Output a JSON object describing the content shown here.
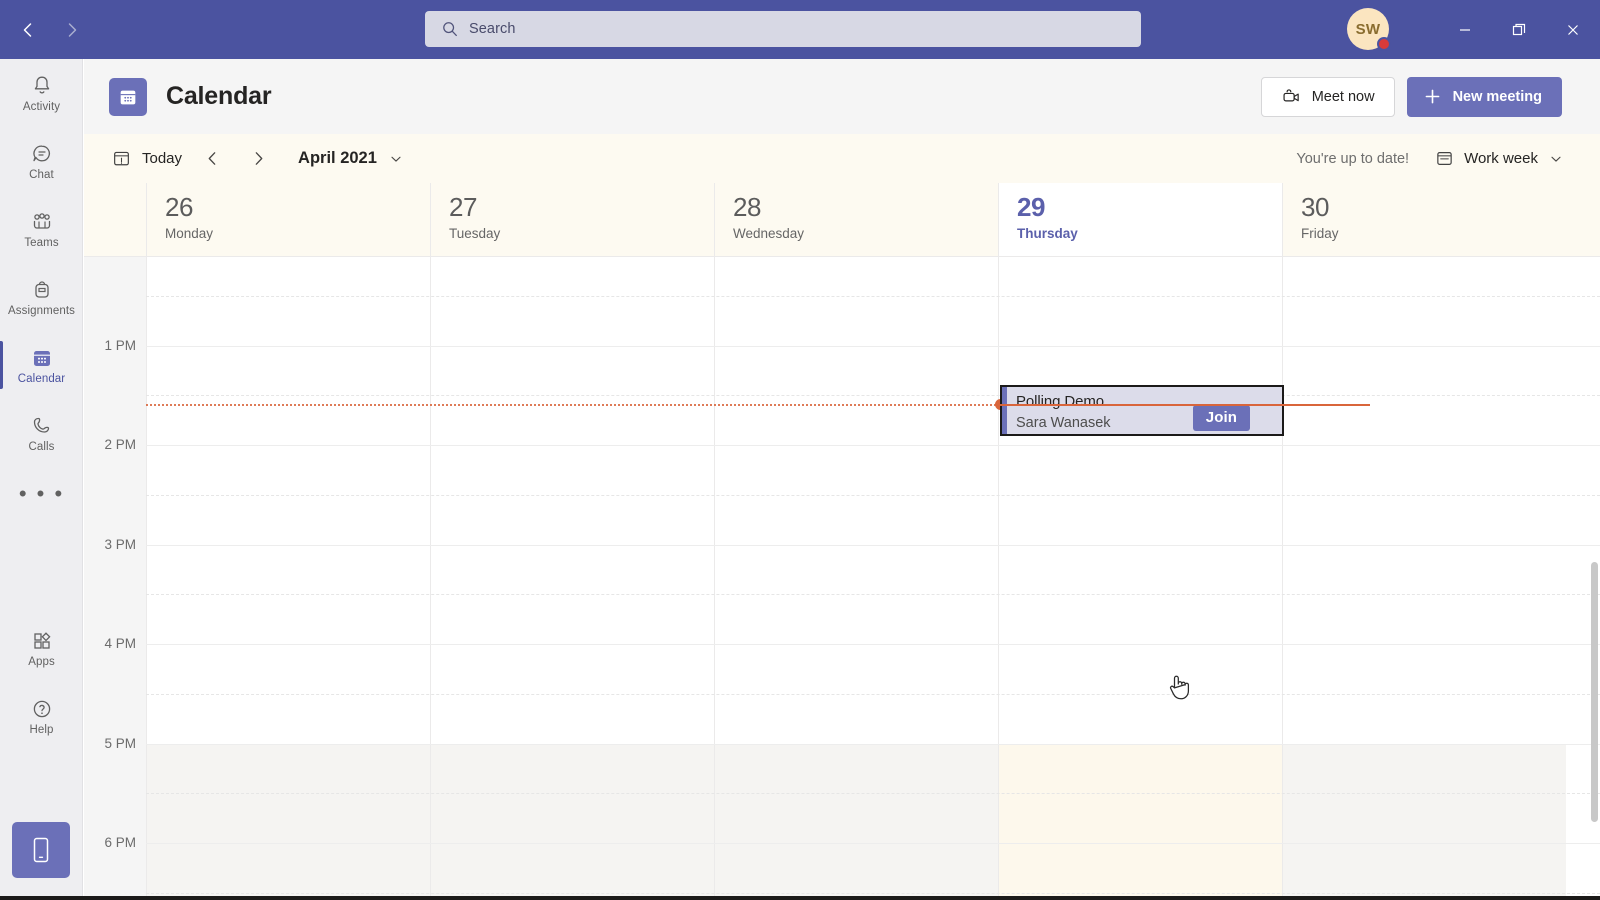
{
  "titlebar": {
    "back_label": "Back",
    "forward_label": "Forward",
    "search_placeholder": "Search",
    "avatar_initials": "SW",
    "minimize_label": "Minimize",
    "maximize_label": "Restore",
    "close_label": "Close"
  },
  "rail": {
    "items": [
      {
        "label": "Activity",
        "icon": "bell-icon",
        "active": false
      },
      {
        "label": "Chat",
        "icon": "chat-icon",
        "active": false
      },
      {
        "label": "Teams",
        "icon": "teams-icon",
        "active": false
      },
      {
        "label": "Assignments",
        "icon": "backpack-icon",
        "active": false
      },
      {
        "label": "Calendar",
        "icon": "calendar-icon",
        "active": true
      },
      {
        "label": "Calls",
        "icon": "phone-icon",
        "active": false
      }
    ],
    "more_label": "• • •",
    "bottom_items": [
      {
        "label": "Apps",
        "icon": "apps-icon"
      },
      {
        "label": "Help",
        "icon": "help-icon"
      }
    ],
    "mobile_button_label": "Get the mobile app"
  },
  "header": {
    "app_icon": "calendar-icon",
    "title": "Calendar",
    "meet_now_label": "Meet now",
    "new_meeting_label": "New meeting"
  },
  "toolbar": {
    "today_label": "Today",
    "prev_label": "Previous week",
    "next_label": "Next week",
    "month_label": "April 2021",
    "up_to_date_label": "You're up to date!",
    "view_label": "Work week"
  },
  "calendar": {
    "days": [
      {
        "num": "26",
        "name": "Monday",
        "today": false
      },
      {
        "num": "27",
        "name": "Tuesday",
        "today": false
      },
      {
        "num": "28",
        "name": "Wednesday",
        "today": false
      },
      {
        "num": "29",
        "name": "Thursday",
        "today": true
      },
      {
        "num": "30",
        "name": "Friday",
        "today": false
      }
    ],
    "time_labels": [
      "1 PM",
      "2 PM",
      "3 PM",
      "4 PM",
      "5 PM",
      "6 PM"
    ],
    "events": [
      {
        "title": "Polling Demo",
        "organizer": "Sara Wanasek",
        "join_label": "Join",
        "day_index": 3,
        "accent_color": "#6b70b8"
      }
    ]
  },
  "colors": {
    "brand": "#4b53a0",
    "accent": "#6b70b8",
    "now_line": "#d9653b",
    "today_tint": "#fdf8ec"
  }
}
